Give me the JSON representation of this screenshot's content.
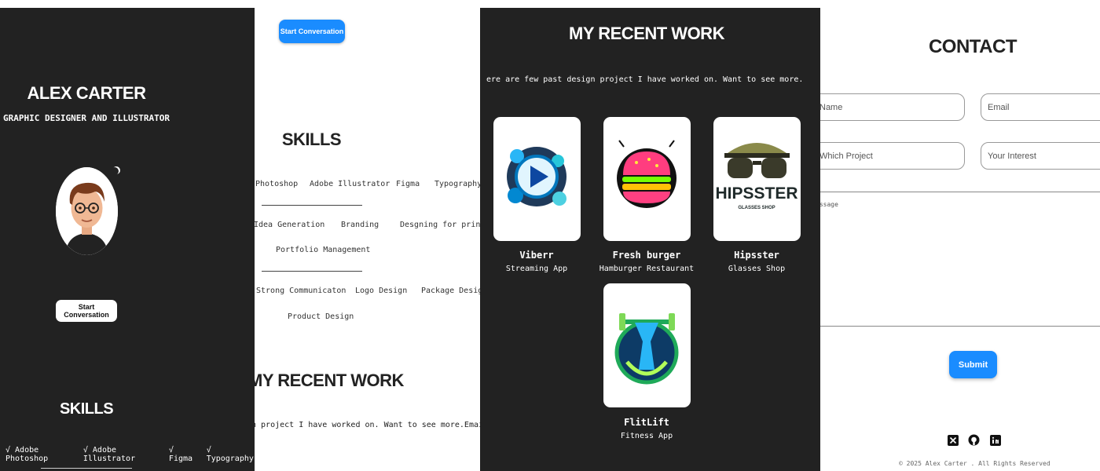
{
  "hero": {
    "name": "ALEX CARTER",
    "subtitle": "GRAPHIC DESIGNER AND ILLUSTRATOR",
    "cta_label": "Start Conversation"
  },
  "skills_dark": {
    "title": "SKILLS",
    "items": [
      "√ Adobe Photoshop",
      "√ Adobe Illustrator",
      "√ Figma",
      "√ Typography"
    ]
  },
  "light_view": {
    "cta_label": "Start Conversation",
    "skills_title": "SKILLS",
    "row1": [
      "Photoshop",
      "Adobe Illustrator",
      "Figma",
      "Typography"
    ],
    "row2": [
      "Idea Generation",
      "Branding",
      "Desgning for print"
    ],
    "row3": [
      "Portfolio Management"
    ],
    "row4": [
      "Strong Communicaton",
      "Logo Design",
      "Package Design"
    ],
    "row5": [
      "Product Design"
    ],
    "recent_title": "MY RECENT WORK",
    "recent_desc": "n project I have worked on. Want to see more.Email me"
  },
  "recent_work": {
    "title": "MY RECENT WORK",
    "desc": "ere are few past design project I have worked on. Want to see more.",
    "projects": [
      {
        "name": "Viberr",
        "sub": "Streaming App",
        "icon": "play-logo-icon"
      },
      {
        "name": "Fresh burger",
        "sub": "Hamburger Restaurant",
        "icon": "burger-logo-icon"
      },
      {
        "name": "Hipsster",
        "sub": "Glasses Shop",
        "icon": "glasses-logo-icon",
        "logo_text": "HIPSSTER",
        "logo_sub": "GLASSES SHOP"
      },
      {
        "name": "FlitLift",
        "sub": "Fitness App",
        "icon": "fitness-logo-icon"
      }
    ]
  },
  "contact": {
    "title": "CONTACT",
    "name_placeholder": "Name",
    "email_placeholder": "Email",
    "project_placeholder": "Which Project",
    "interest_placeholder": "Your Interest",
    "message_label": "essage",
    "submit_label": "Submit",
    "footer": "© 2025 Alex Carter . All Rights Reserved",
    "socials": [
      "x-icon",
      "github-icon",
      "linkedin-icon"
    ]
  },
  "colors": {
    "accent": "#1a8cff",
    "dark_bg": "#222222"
  }
}
